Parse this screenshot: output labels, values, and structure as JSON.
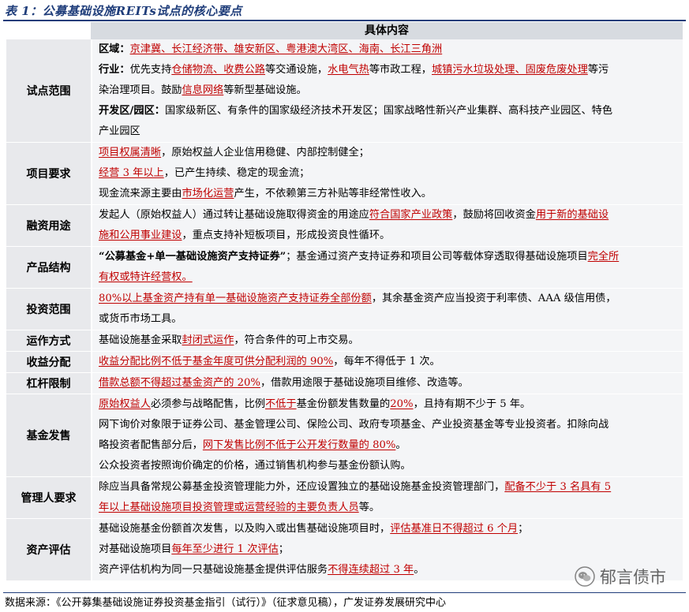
{
  "title": "表 1：公募基础设施REITs试点的核心要点",
  "header": {
    "content": "具体内容"
  },
  "rows": [
    {
      "label": "试点范围",
      "lines": [
        [
          {
            "t": "区域：",
            "b": true
          },
          {
            "t": "京津冀、长江经济带、雄安新区、粤港澳大湾区、海南、长江三角洲",
            "h": true
          }
        ],
        [
          {
            "t": "行业：",
            "b": true
          },
          {
            "t": "优先支持"
          },
          {
            "t": "仓储物流、收费公路",
            "h": true
          },
          {
            "t": "等交通设施，"
          },
          {
            "t": "水电气热",
            "h": true
          },
          {
            "t": "等市政工程，"
          },
          {
            "t": "城镇污水垃圾处理、固废危废处理",
            "h": true
          },
          {
            "t": "等污"
          }
        ],
        [
          {
            "t": "染治理项目。鼓励"
          },
          {
            "t": "信息网络",
            "h": true
          },
          {
            "t": "等新型基础设施。"
          }
        ],
        [
          {
            "t": "开发区/园区：",
            "b": true
          },
          {
            "t": "国家级新区、有条件的国家级经济技术开发区；国家战略性新兴产业集群、高科技产业园区、特色"
          }
        ],
        [
          {
            "t": "产业园区"
          }
        ]
      ]
    },
    {
      "label": "项目要求",
      "lines": [
        [
          {
            "t": "项目权属清晰",
            "h": true
          },
          {
            "t": "，原始权益人企业信用稳健、内部控制健全；"
          }
        ],
        [
          {
            "t": "经营 3 年以上",
            "h": true
          },
          {
            "t": "，已产生持续、稳定的现金流；"
          }
        ],
        [
          {
            "t": "现金流来源主要由"
          },
          {
            "t": "市场化运营",
            "h": true
          },
          {
            "t": "产生，不依赖第三方补贴等非经常性收入。"
          }
        ]
      ]
    },
    {
      "label": "融资用途",
      "lines": [
        [
          {
            "t": "发起人（原始权益人）通过转让基础设施取得资金的用途应"
          },
          {
            "t": "符合国家产业政策",
            "h": true
          },
          {
            "t": "，鼓励将回收资金"
          },
          {
            "t": "用于新的基础设",
            "h": true
          }
        ],
        [
          {
            "t": "施和公用事业建设",
            "h": true
          },
          {
            "t": "，重点支持补短板项目，形成投资良性循环。"
          }
        ]
      ]
    },
    {
      "label": "产品结构",
      "lines": [
        [
          {
            "t": "“公募基金+单一基础设施资产支持证券”",
            "b": true
          },
          {
            "t": "；基金通过资产支持证券和项目公司等载体穿透取得基础设施项目"
          },
          {
            "t": "完全所",
            "h": true
          }
        ],
        [
          {
            "t": "有权或特许经营权。",
            "h": true
          }
        ]
      ]
    },
    {
      "label": "投资范围",
      "lines": [
        [
          {
            "t": "80%以上基金资产持有单一基础设施资产支持证券全部份额",
            "h": true
          },
          {
            "t": "，其余基金资产应当投资于利率债、AAA 级信用债，"
          }
        ],
        [
          {
            "t": "或货币市场工具。"
          }
        ]
      ]
    },
    {
      "label": "运作方式",
      "lines": [
        [
          {
            "t": "基础设施基金采取"
          },
          {
            "t": "封闭式运作",
            "h": true
          },
          {
            "t": "，符合条件的可上市交易。"
          }
        ]
      ]
    },
    {
      "label": "收益分配",
      "lines": [
        [
          {
            "t": "收益分配比例不低于基金年度可供分配利润的 90%",
            "h": true
          },
          {
            "t": "，每年不得低于 1 次。"
          }
        ]
      ]
    },
    {
      "label": "杠杆限制",
      "lines": [
        [
          {
            "t": "借款总额不得超过基金资产的 20%",
            "h": true
          },
          {
            "t": "，借款用途限于基础设施项目维修、改造等。"
          }
        ]
      ]
    },
    {
      "label": "基金发售",
      "lines": [
        [
          {
            "t": "原始权益人",
            "h": true
          },
          {
            "t": "必须参与战略配售，比例"
          },
          {
            "t": "不低于",
            "h": true
          },
          {
            "t": "基金份额发售数量的"
          },
          {
            "t": "20%",
            "h": true
          },
          {
            "t": "，且持有期不少于 5 年。"
          }
        ],
        [
          {
            "t": "网下询价对象限于证券公司、基金管理公司、保险公司、政府专项基金、产业投资基金等专业投资者。扣除向战"
          }
        ],
        [
          {
            "t": "略投资者配售部分后，"
          },
          {
            "t": "网下发售比例不低于公开发行数量的 80%",
            "h": true
          },
          {
            "t": "。"
          }
        ],
        [
          {
            "t": "公众投资者按照询价确定的价格，通过销售机构参与基金份额认购。"
          }
        ]
      ]
    },
    {
      "label": "管理人要求",
      "lines": [
        [
          {
            "t": "除应当具备常规公募基金投资管理能力外，还应设置独立的基础设施基金投资管理部门，"
          },
          {
            "t": "配备不少于 3 名具有 5",
            "h": true
          }
        ],
        [
          {
            "t": "年以上基础设施项目投资管理或运营经验的主要负责人员",
            "h": true
          },
          {
            "t": "等。"
          }
        ]
      ]
    },
    {
      "label": "资产评估",
      "lines": [
        [
          {
            "t": "基础设施基金份额首次发售，以及购入或出售基础设施项目时，"
          },
          {
            "t": "评估基准日不得超过 6 个月",
            "h": true
          },
          {
            "t": "；"
          }
        ],
        [
          {
            "t": "对基础设施项目"
          },
          {
            "t": "每年至少进行 1 次评估",
            "h": true
          },
          {
            "t": "；"
          }
        ],
        [
          {
            "t": "资产评估机构为同一只基础设施基金提供评估服务"
          },
          {
            "t": "不得连续超过 3 年",
            "h": true
          },
          {
            "t": "。"
          }
        ]
      ]
    }
  ],
  "source": "数据来源：《公开募集基础设施证券投资基金指引（试行）》（征求意见稿），广发证券发展研究中心",
  "watermark": {
    "icon": "wechat-icon",
    "text": "郁言债市"
  },
  "colors": {
    "highlight": "#c00000",
    "title": "#1f3d7a",
    "header_bg": "#d7dbe0",
    "label_bg": "#e8e9ec",
    "content_bg": "#f4f5f7"
  }
}
